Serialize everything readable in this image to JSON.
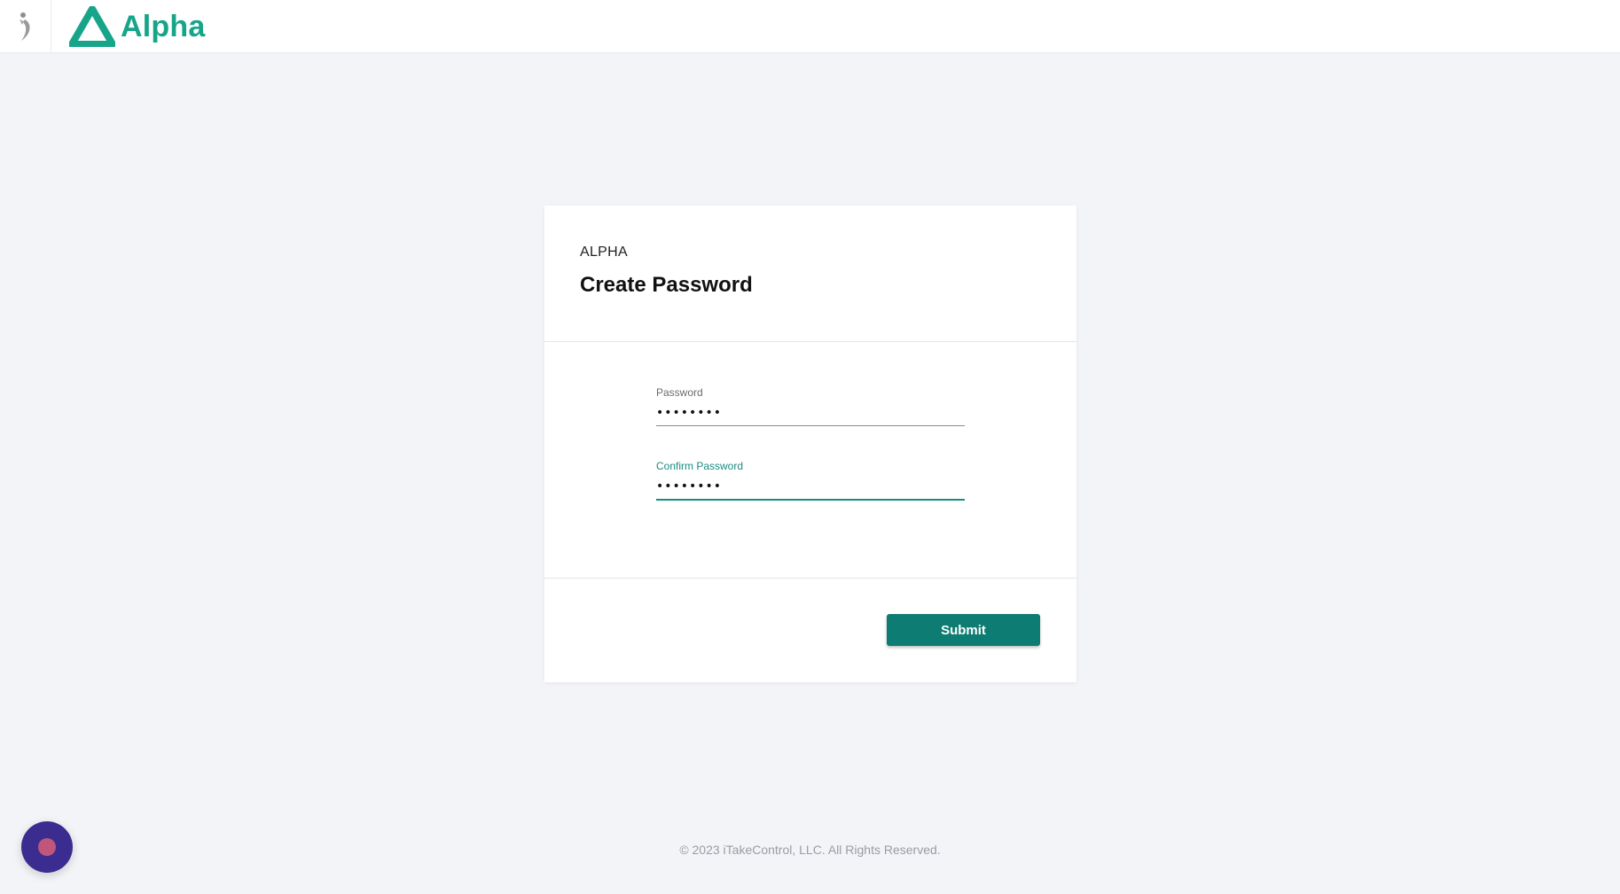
{
  "header": {
    "brand_name": "Alpha",
    "brand_color": "#17a58a",
    "left_icon": "figure-icon",
    "logo_icon": "alpha-logo-icon"
  },
  "card": {
    "eyebrow": "ALPHA",
    "title": "Create Password",
    "password": {
      "label": "Password",
      "value": "••••••••"
    },
    "confirm_password": {
      "label": "Confirm Password",
      "value": "••••••••",
      "focused": true
    },
    "submit_label": "Submit",
    "accent_color": "#0d7c72"
  },
  "footer": {
    "copyright": "© 2023 iTakeControl, LLC. All Rights Reserved."
  },
  "chat": {
    "icon": "chat-launcher-icon",
    "color": "#3a2d8f"
  }
}
